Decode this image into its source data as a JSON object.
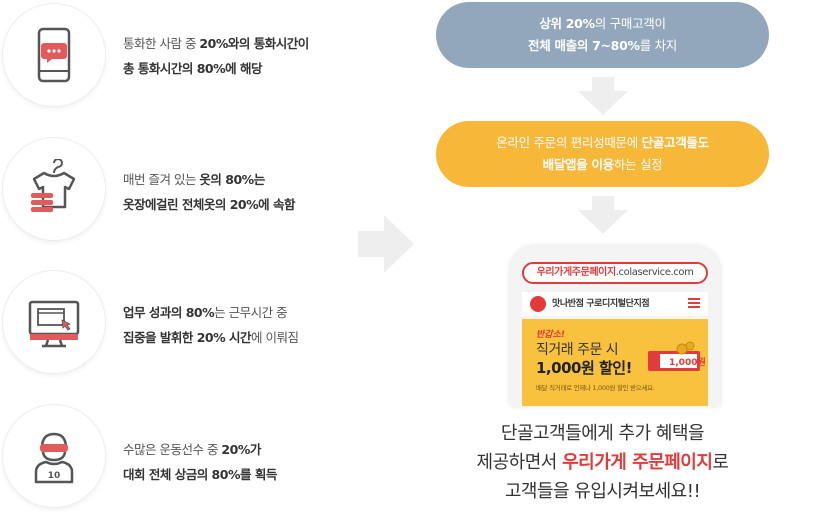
{
  "rows": [
    {
      "icon": "phone-chat-icon",
      "line1_a": "통화한 사람 중 ",
      "line1_b": "20%와의 통화시간이",
      "line2": "총 통화시간의 80%에 해당"
    },
    {
      "icon": "clothes-icon",
      "line1_a": "매번 즐겨 있는 ",
      "line1_b": "옷의 80%는",
      "line2": "옷장에걸린 전체옷의 20%에 속함"
    },
    {
      "icon": "monitor-icon",
      "line1_a": "업무 성과의 80%",
      "line1_b": "는 근무시간 중",
      "line2_a": "집중을 발휘한 20% 시간",
      "line2_b": "에 이뤄짐"
    },
    {
      "icon": "athlete-icon",
      "line1_a": "수많은 운동선수 중 ",
      "line1_b": "20%가",
      "line2": "대회 전체 상금의 80%를 획득",
      "jersey": "10"
    }
  ],
  "pill1": {
    "l1_bold": "상위 20%",
    "l1_rest": "의 구매고객이",
    "l2_bold": "전체 매출의 7~80%",
    "l2_rest": "를 차지"
  },
  "pill2": {
    "l1_a": "온라인 주문의 편리성때문에 ",
    "l1_bold": "단골고객들도",
    "l2_bold": "배달앱을 이용",
    "l2_rest": "하는 실정"
  },
  "phone": {
    "url_red": "우리가게주문페이지",
    "url_rest": ".colaservice.com",
    "store_name": "맛나반점 구로디지털단지점",
    "banner_tag": "반갑소!",
    "banner_line1": "직거래 주문 시",
    "banner_line2": "1,000원 할인!",
    "banner_small": "배달 직거래로 언제나 1,000원 할인 받으세요.",
    "coupon_value": "1,000원"
  },
  "bottom": {
    "line1": "단골고객들에게 추가 혜택을",
    "line2_a": "제공하면서 ",
    "line2_hl": "우리가게 주문페이지",
    "line2_b": "로",
    "line3": "고객들을 유입시켜보세요!!"
  },
  "colors": {
    "accent_red": "#e33b3b",
    "pill_blue": "#93a7bc",
    "pill_orange": "#f7b739",
    "banner_yellow": "#f8c23e"
  }
}
